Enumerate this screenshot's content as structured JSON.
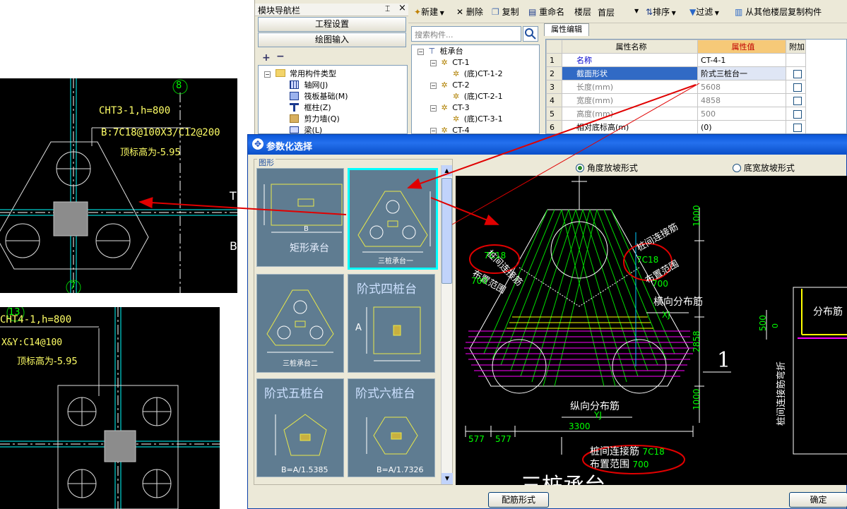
{
  "nav": {
    "title": "模块导航栏",
    "pin": "⌶",
    "close": "×",
    "project_settings": "工程设置",
    "drawing_input": "绘图输入",
    "tree": [
      {
        "label": "常用构件类型",
        "icon": "folder-icon",
        "level": 0
      },
      {
        "label": "轴网(J)",
        "icon": "axis-grid-icon",
        "level": 1
      },
      {
        "label": "筏板基础(M)",
        "icon": "raft-icon",
        "level": 1
      },
      {
        "label": "框柱(Z)",
        "icon": "column-icon",
        "level": 1
      },
      {
        "label": "剪力墙(Q)",
        "icon": "wall-icon",
        "level": 1
      },
      {
        "label": "梁(L)",
        "icon": "beam-icon",
        "level": 1
      }
    ]
  },
  "toolbar": {
    "new": "新建",
    "delete": "删除",
    "copy": "复制",
    "rename": "重命名",
    "floor_label": "楼层",
    "floor_value": "首层",
    "sort": "排序",
    "filter": "过滤",
    "copy_from_floor": "从其他楼层复制构件"
  },
  "search": {
    "placeholder": "搜索构件..."
  },
  "component_tree": [
    {
      "label": "桩承台",
      "level": 0
    },
    {
      "label": "CT-1",
      "level": 1
    },
    {
      "label": "(底)CT-1-2",
      "level": 2
    },
    {
      "label": "CT-2",
      "level": 1
    },
    {
      "label": "(底)CT-2-1",
      "level": 2
    },
    {
      "label": "CT-3",
      "level": 1
    },
    {
      "label": "(底)CT-3-1",
      "level": 2
    },
    {
      "label": "CT-4",
      "level": 1
    }
  ],
  "props": {
    "tab": "属性编辑",
    "headers": [
      "属性名称",
      "属性值",
      "附加"
    ],
    "rows": [
      {
        "n": "1",
        "name": "名称",
        "value": "CT-4-1",
        "check": false,
        "name_color": "#0000cc"
      },
      {
        "n": "2",
        "name": "截面形状",
        "value": "阶式三桩台一",
        "check": true,
        "name_color": "#ffffff"
      },
      {
        "n": "3",
        "name": "长度(mm)",
        "value": "5608",
        "check": true,
        "name_color": "#808080"
      },
      {
        "n": "4",
        "name": "宽度(mm)",
        "value": "4858",
        "check": true,
        "name_color": "#808080"
      },
      {
        "n": "5",
        "name": "高度(mm)",
        "value": "500",
        "check": true,
        "name_color": "#808080"
      },
      {
        "n": "6",
        "name": "相对底标高(m)",
        "value": "(0)",
        "check": true,
        "name_color": "#000000"
      }
    ]
  },
  "dialog": {
    "title": "参数化选择",
    "group_label": "图形",
    "radio1": "角度放坡形式",
    "radio2": "底宽放坡形式",
    "btn_rebar": "配筋形式",
    "btn_ok": "确定",
    "shapes": [
      {
        "label": "矩形承台",
        "sub": "B"
      },
      {
        "label": "三桩承台一",
        "sub": ""
      },
      {
        "label": "三桩承台二",
        "sub": ""
      },
      {
        "label": "阶式四桩台",
        "sub": "A"
      },
      {
        "label": "阶式五桩台",
        "sub": "B=A/1.5385"
      },
      {
        "label": "阶式六桩台",
        "sub": "B=A/1.7326"
      }
    ],
    "preview": {
      "left_note_1": "桩间连接筋",
      "left_note_2": "7C18",
      "left_note_3": "布置范围",
      "left_note_4": "700",
      "right_note_1": "桩间连接筋",
      "right_note_2": "7C18",
      "right_note_3": "布置范围",
      "right_note_4": "700",
      "horiz_dist": "横向分布筋",
      "xj": "XJ",
      "long_dist": "纵向分布筋",
      "yj": "YJ",
      "dim_1000a": "1000",
      "dim_2858": "2858",
      "dim_1000b": "1000",
      "dim_3300": "3300",
      "dim_577a": "577",
      "dim_577b": "577",
      "section_mark": "1",
      "bottom_note_1": "桩间连接筋",
      "bottom_note_2": "7C18",
      "bottom_note_3": "布置范围",
      "bottom_note_4": "700",
      "bottom_title": "三桩承台",
      "side_500": "500",
      "side_0": "0",
      "side_dist": "分布筋",
      "side_vertical": "桩间连接筋弯折"
    }
  },
  "cad_top": {
    "axis": "8",
    "axis_bottom": "7",
    "label1": "CHT3-1,h=800",
    "label2": "B:7C18@100X3/C12@200",
    "label3": "顶标高为-5.95",
    "right_t": "T",
    "right_b": "B"
  },
  "cad_bottom": {
    "axis": "13",
    "label1": "CHT4-1,h=800",
    "label2": "X&Y:C14@100",
    "label3": "顶标高为-5.95"
  },
  "colors": {
    "highlight_cyan": "#00ffff",
    "red_annotation": "#e00000",
    "cad_green": "#00ff00",
    "cad_yellow": "#ffff00",
    "cad_magenta": "#ff00ff"
  }
}
